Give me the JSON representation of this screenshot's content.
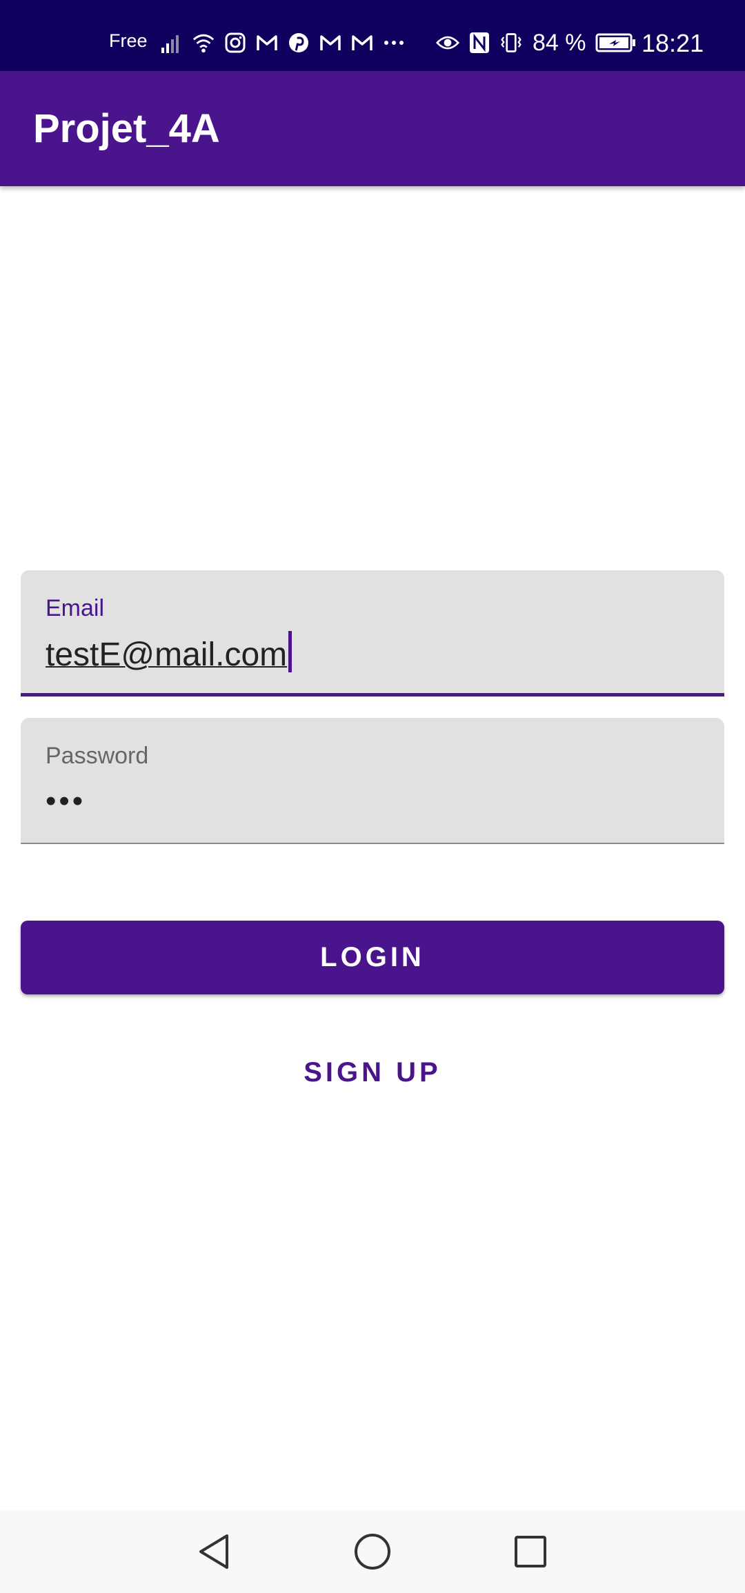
{
  "status_bar": {
    "carrier": "Free",
    "battery_percent": "84 %",
    "time": "18:21",
    "icons_left": [
      "signal-icon",
      "wifi-icon",
      "instagram-icon",
      "gmail-icon",
      "pinterest-icon",
      "gmail-icon",
      "gmail-icon",
      "more-notifications-icon"
    ],
    "icons_right": [
      "eye-comfort-icon",
      "nfc-icon",
      "vibrate-icon",
      "battery-charging-icon"
    ]
  },
  "app_bar": {
    "title": "Projet_4A"
  },
  "form": {
    "email": {
      "label": "Email",
      "value": "testE@mail.com"
    },
    "password": {
      "label": "Password",
      "value": "•••"
    },
    "login_label": "LOGIN",
    "signup_label": "SIGN UP"
  },
  "nav_bar": {
    "buttons": [
      "back-icon",
      "home-icon",
      "recents-icon"
    ]
  },
  "colors": {
    "primary": "#4a148c",
    "status_bar": "#12005e",
    "field_background": "#e1e1e1",
    "nav_bar": "#f8f8f8"
  }
}
